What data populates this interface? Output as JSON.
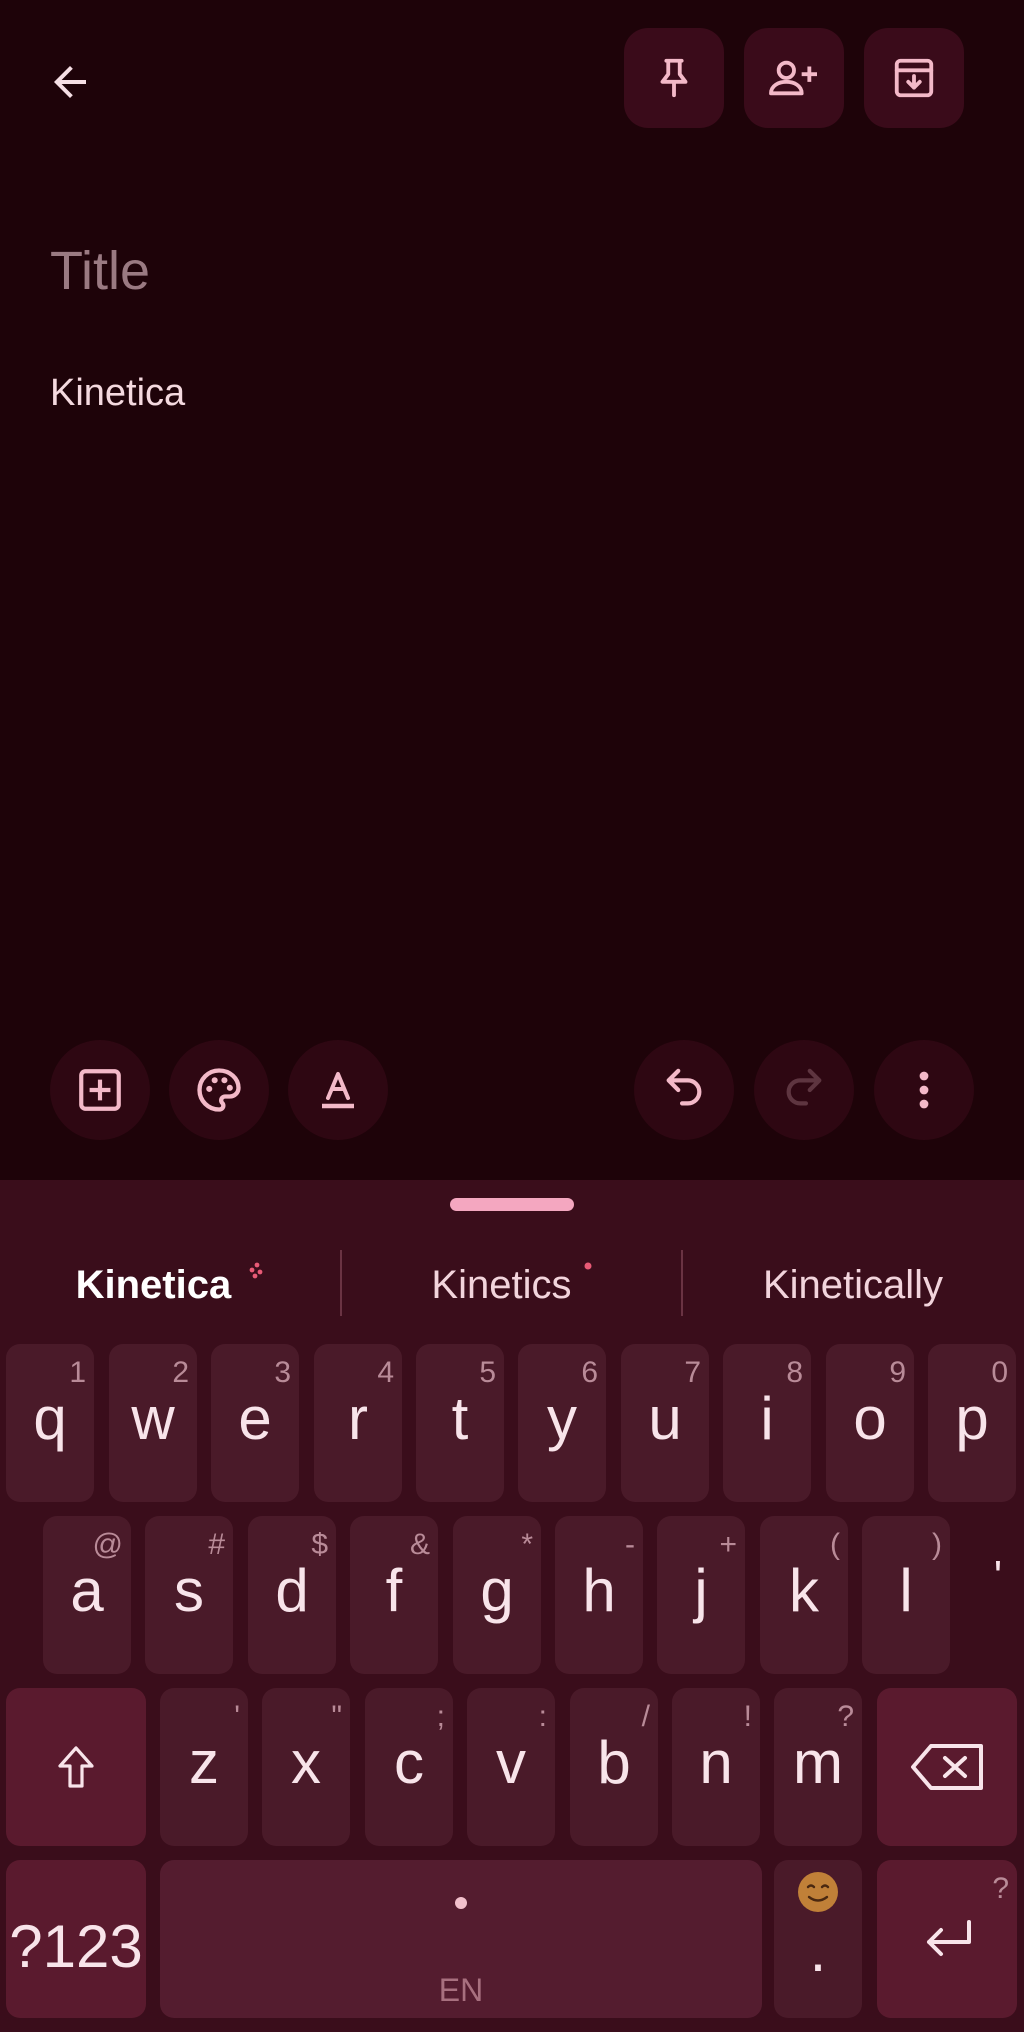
{
  "editor": {
    "title_placeholder": "Title",
    "body_text": "Kinetica"
  },
  "icons": {
    "back": "arrow-left-icon",
    "pin": "pin-icon",
    "collaborator": "add-person-icon",
    "archive": "archive-icon",
    "add": "add-box-icon",
    "palette": "palette-icon",
    "text_format": "text-format-icon",
    "undo": "undo-icon",
    "redo": "redo-icon",
    "more": "more-vert-icon"
  },
  "keyboard": {
    "suggestions": [
      "Kinetica",
      "Kinetics",
      "Kinetically"
    ],
    "row1": [
      {
        "k": "q",
        "h": "1"
      },
      {
        "k": "w",
        "h": "2"
      },
      {
        "k": "e",
        "h": "3"
      },
      {
        "k": "r",
        "h": "4"
      },
      {
        "k": "t",
        "h": "5"
      },
      {
        "k": "y",
        "h": "6"
      },
      {
        "k": "u",
        "h": "7"
      },
      {
        "k": "i",
        "h": "8"
      },
      {
        "k": "o",
        "h": "9"
      },
      {
        "k": "p",
        "h": "0"
      }
    ],
    "row2": [
      {
        "k": "a",
        "h": "@"
      },
      {
        "k": "s",
        "h": "#"
      },
      {
        "k": "d",
        "h": "$"
      },
      {
        "k": "f",
        "h": "&"
      },
      {
        "k": "g",
        "h": "*"
      },
      {
        "k": "h",
        "h": "-"
      },
      {
        "k": "j",
        "h": "+"
      },
      {
        "k": "k",
        "h": "("
      },
      {
        "k": "l",
        "h": ")"
      }
    ],
    "row2_extra": "'",
    "row3": [
      {
        "k": "z",
        "h": "'"
      },
      {
        "k": "x",
        "h": "\""
      },
      {
        "k": "c",
        "h": ";"
      },
      {
        "k": "v",
        "h": ":"
      },
      {
        "k": "b",
        "h": "/"
      },
      {
        "k": "n",
        "h": "!"
      },
      {
        "k": "m",
        "h": "?"
      }
    ],
    "symbols_label": "?123",
    "space_label": "EN",
    "period": ".",
    "enter_hint": "?"
  },
  "colors": {
    "background": "#1e0309",
    "accent": "#f4a7c0",
    "key": "#4a1a29"
  }
}
